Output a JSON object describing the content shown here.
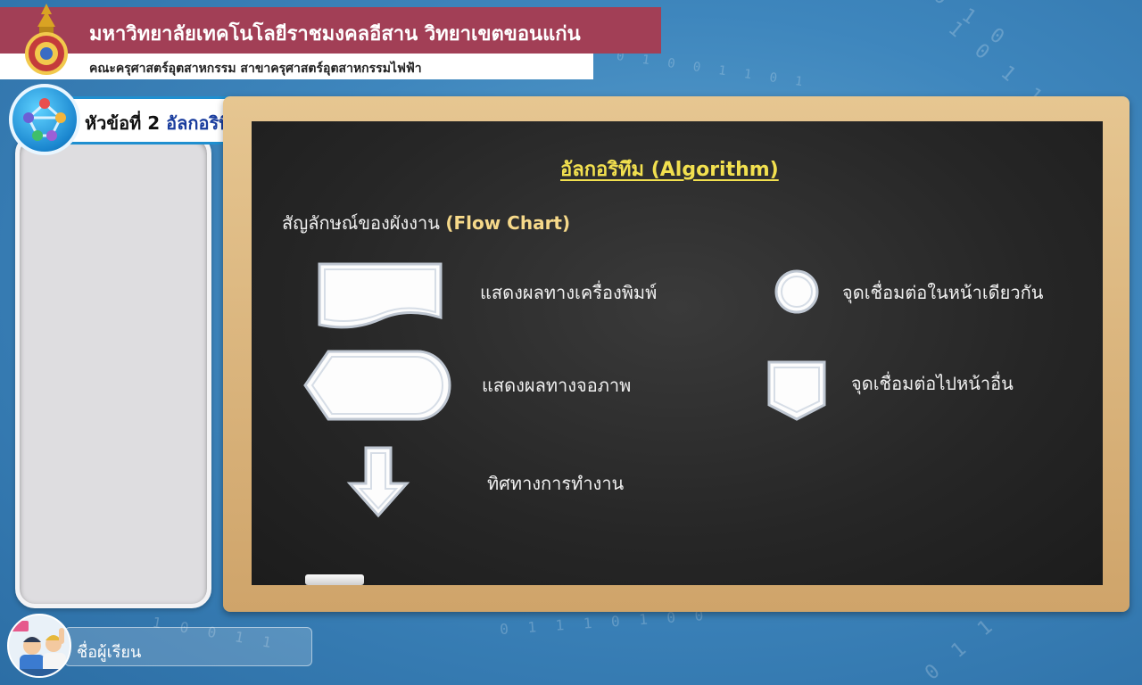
{
  "header": {
    "university": "มหาวิทยาลัยเทคโนโลยีราชมงคลอีสาน วิทยาเขตขอนแก่น",
    "faculty": "คณะครุศาสตร์อุตสาหกรรม สาขาครุศาสตร์อุตสาหกรรมไฟฟ้า"
  },
  "topic": {
    "prefix": "หัวข้อที่ 2",
    "name": "อัลกอริทึม"
  },
  "board": {
    "title": "อัลกอริทึม (Algorithm)",
    "section_prefix": "สัญลักษณ์ของผังงาน",
    "section_suffix": "(Flow Chart)",
    "symbols": [
      {
        "icon": "printed-document-symbol-icon",
        "label": "แสดงผลทางเครื่องพิมพ์"
      },
      {
        "icon": "display-symbol-icon",
        "label": "แสดงผลทางจอภาพ"
      },
      {
        "icon": "flow-arrow-symbol-icon",
        "label": "ทิศทางการทำงาน"
      },
      {
        "icon": "on-page-connector-icon",
        "label": "จุดเชื่อมต่อในหน้าเดียวกัน"
      },
      {
        "icon": "off-page-connector-icon",
        "label": "จุดเชื่อมต่อไปหน้าอื่น"
      }
    ]
  },
  "footer": {
    "student_name_label": "ชื่อผู้เรียน"
  },
  "background_digits": [
    "0 1 0",
    "1 0 1 1",
    "0 1 1 0 1",
    "0 1 1 1 0 1 0 0",
    "0 1 0 0 1 1 0 1",
    "1 0 0 1 1"
  ],
  "colors": {
    "header_bg": "#a23f56",
    "board_title": "#f2e04f",
    "accent_blue": "#1f8fd0"
  }
}
